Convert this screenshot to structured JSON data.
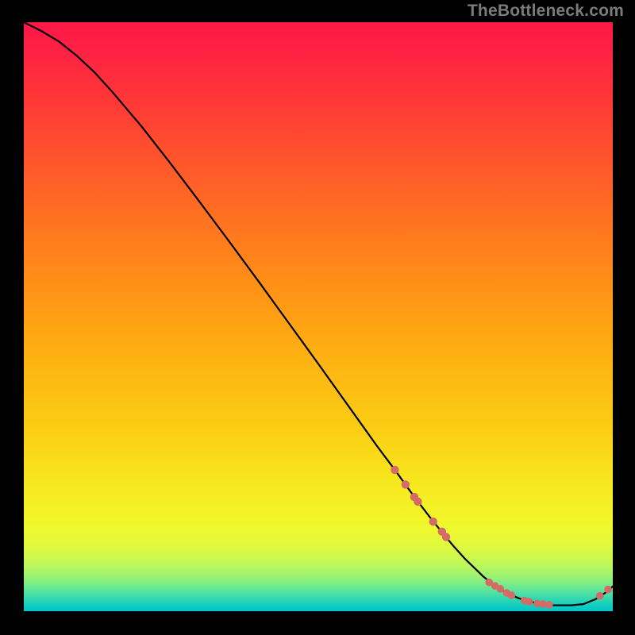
{
  "watermark": "TheBottleneck.com",
  "chart_data": {
    "type": "line",
    "title": "",
    "xlabel": "",
    "ylabel": "",
    "xlim": [
      0,
      100
    ],
    "ylim": [
      0,
      100
    ],
    "grid": false,
    "legend": false,
    "series": [
      {
        "name": "curve",
        "x": [
          0,
          3,
          6,
          9,
          12,
          15,
          20,
          25,
          30,
          35,
          40,
          45,
          50,
          55,
          60,
          63,
          65,
          67,
          69,
          71,
          73,
          75,
          78,
          80,
          82,
          84,
          86,
          88,
          90,
          93,
          95,
          97,
          99,
          100
        ],
        "y": [
          100,
          98.5,
          96.7,
          94.3,
          91.5,
          88.2,
          82.3,
          75.9,
          69.3,
          62.6,
          55.8,
          48.9,
          42.0,
          35.0,
          28.0,
          24.0,
          21.2,
          18.5,
          15.9,
          13.4,
          11.0,
          8.8,
          5.9,
          4.3,
          3.1,
          2.2,
          1.6,
          1.2,
          1.0,
          1.0,
          1.2,
          2.0,
          3.3,
          4.2
        ],
        "color": "#000000"
      }
    ],
    "markers": [
      {
        "x": 63.0,
        "y": 24.0,
        "r": 5.2,
        "color": "#d56b67"
      },
      {
        "x": 64.8,
        "y": 21.5,
        "r": 5.2,
        "color": "#d56b67"
      },
      {
        "x": 66.3,
        "y": 19.4,
        "r": 5.2,
        "color": "#d56b67"
      },
      {
        "x": 66.9,
        "y": 18.6,
        "r": 5.2,
        "color": "#d56b67"
      },
      {
        "x": 69.5,
        "y": 15.2,
        "r": 5.2,
        "color": "#d56b67"
      },
      {
        "x": 71.0,
        "y": 13.5,
        "r": 5.2,
        "color": "#d56b67"
      },
      {
        "x": 71.7,
        "y": 12.6,
        "r": 5.2,
        "color": "#d56b67"
      },
      {
        "x": 79.0,
        "y": 4.9,
        "r": 4.8,
        "color": "#d56b67"
      },
      {
        "x": 80.0,
        "y": 4.3,
        "r": 4.8,
        "color": "#d56b67"
      },
      {
        "x": 80.9,
        "y": 3.8,
        "r": 4.8,
        "color": "#d56b67"
      },
      {
        "x": 82.0,
        "y": 3.1,
        "r": 4.8,
        "color": "#d56b67"
      },
      {
        "x": 82.8,
        "y": 2.7,
        "r": 4.8,
        "color": "#d56b67"
      },
      {
        "x": 85.0,
        "y": 1.8,
        "r": 4.8,
        "color": "#d56b67"
      },
      {
        "x": 85.8,
        "y": 1.6,
        "r": 4.8,
        "color": "#d56b67"
      },
      {
        "x": 87.2,
        "y": 1.3,
        "r": 4.8,
        "color": "#d56b67"
      },
      {
        "x": 88.2,
        "y": 1.2,
        "r": 4.8,
        "color": "#d56b67"
      },
      {
        "x": 89.2,
        "y": 1.1,
        "r": 4.8,
        "color": "#d56b67"
      },
      {
        "x": 97.8,
        "y": 2.6,
        "r": 4.8,
        "color": "#d56b67"
      },
      {
        "x": 99.2,
        "y": 3.7,
        "r": 4.8,
        "color": "#d56b67"
      }
    ]
  }
}
